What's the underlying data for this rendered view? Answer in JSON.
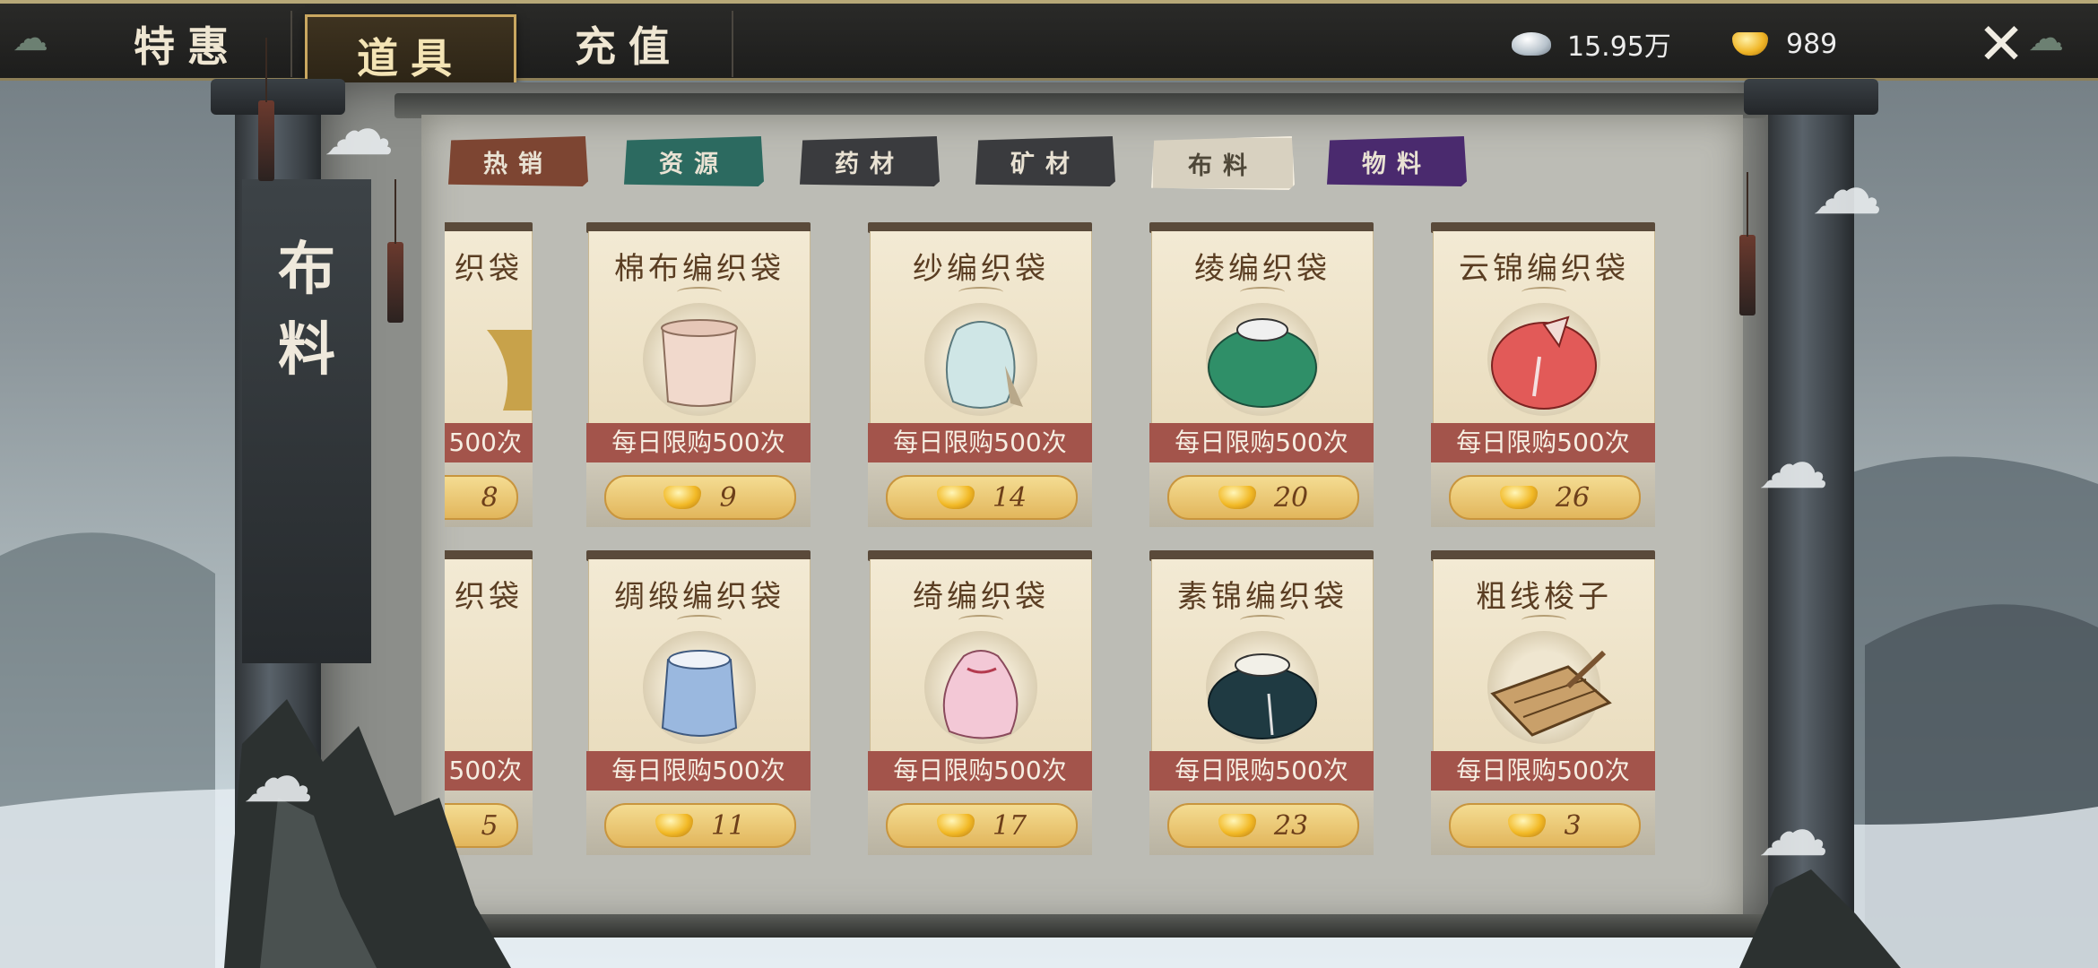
{
  "top_tabs": [
    {
      "label": "特惠",
      "active": false
    },
    {
      "label": "道具",
      "active": true
    },
    {
      "label": "充值",
      "active": false
    }
  ],
  "currency": {
    "silver": {
      "icon": "silver-ingot-icon",
      "value": "15.95万"
    },
    "gold": {
      "icon": "gold-ingot-icon",
      "value": "989"
    }
  },
  "close_icon": "close-x-icon",
  "section_title": [
    "布",
    "料"
  ],
  "categories": [
    {
      "label": "热销",
      "color": "#7d4532"
    },
    {
      "label": "资源",
      "color": "#2c6a60"
    },
    {
      "label": "药材",
      "color": "#3a3b3e"
    },
    {
      "label": "矿材",
      "color": "#3a3b3e"
    },
    {
      "label": "布料",
      "color": "#d8d1c0",
      "selected": true
    },
    {
      "label": "物料",
      "color": "#4a2a6e"
    }
  ],
  "items": [
    {
      "name": "织袋",
      "limit": "500次",
      "price": "8",
      "icon": "yellow-cloth-bag-icon",
      "partial": true
    },
    {
      "name": "棉布编织袋",
      "limit": "每日限购500次",
      "price": "9",
      "icon": "cotton-sack-icon"
    },
    {
      "name": "纱编织袋",
      "limit": "每日限购500次",
      "price": "14",
      "icon": "gauze-bag-icon"
    },
    {
      "name": "绫编织袋",
      "limit": "每日限购500次",
      "price": "20",
      "icon": "damask-bag-icon"
    },
    {
      "name": "云锦编织袋",
      "limit": "每日限购500次",
      "price": "26",
      "icon": "brocade-bag-icon"
    },
    {
      "name": "织袋",
      "limit": "500次",
      "price": "5",
      "icon": "cloth-bag-icon",
      "partial": true
    },
    {
      "name": "绸缎编织袋",
      "limit": "每日限购500次",
      "price": "11",
      "icon": "satin-bag-icon"
    },
    {
      "name": "绮编织袋",
      "limit": "每日限购500次",
      "price": "17",
      "icon": "silk-bag-icon"
    },
    {
      "name": "素锦编织袋",
      "limit": "每日限购500次",
      "price": "23",
      "icon": "plain-brocade-bag-icon"
    },
    {
      "name": "粗线梭子",
      "limit": "每日限购500次",
      "price": "3",
      "icon": "shuttle-icon"
    }
  ]
}
